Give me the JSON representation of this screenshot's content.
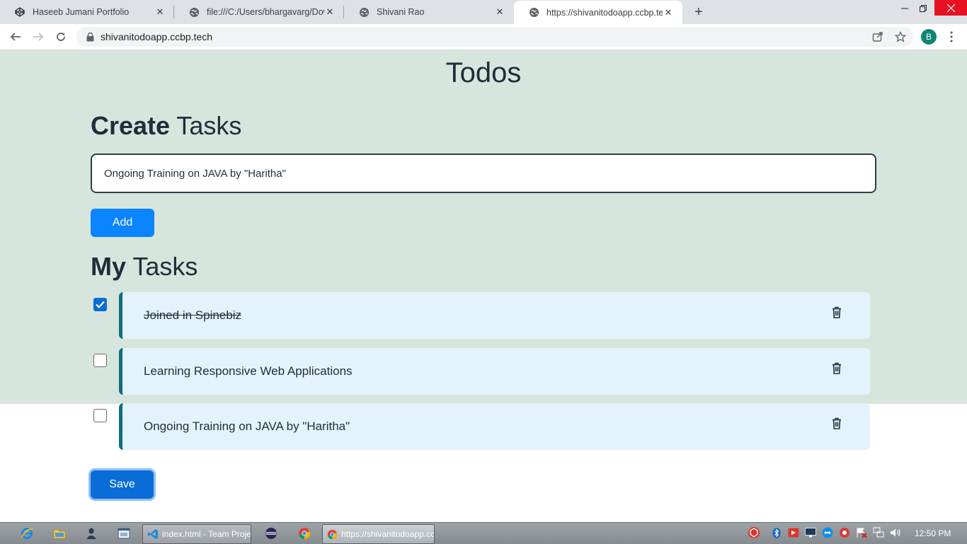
{
  "browser": {
    "tabs": [
      {
        "title": "Haseeb Jumani Portfolio",
        "icon": "codepen-icon"
      },
      {
        "title": "file:///C:/Users/bhargavarg/Downloads",
        "icon": "globe-icon"
      },
      {
        "title": "Shivani Rao",
        "icon": "globe-icon"
      },
      {
        "title": "https://shivanitodoapp.ccbp.tech",
        "icon": "globe-icon"
      }
    ],
    "new_tab_symbol": "+",
    "url": "shivanitodoapp.ccbp.tech",
    "profile_initial": "B"
  },
  "page": {
    "title": "Todos",
    "create_heading": {
      "bold": "Create",
      "rest": " Tasks"
    },
    "input_value": "Ongoing Training on JAVA by \"Haritha\"",
    "add_label": "Add",
    "my_heading": {
      "bold": "My",
      "rest": " Tasks"
    },
    "tasks": [
      {
        "label": "Joined in Spinebiz",
        "checked": true
      },
      {
        "label": "Learning Responsive Web Applications",
        "checked": false
      },
      {
        "label": "Ongoing Training on JAVA by \"Haritha\"",
        "checked": false
      }
    ],
    "save_label": "Save"
  },
  "taskbar": {
    "apps": [
      {
        "label": "index.html - Team Project - Visual Studio Code",
        "icon": "vscode-icon"
      },
      {
        "label": "https://shivanitodoapp.ccbp.tech - Google Chrome",
        "icon": "chrome-icon"
      }
    ],
    "clock": "12:50 PM"
  },
  "colors": {
    "page_bg": "#d7e6dc",
    "primary_button": "#0a84ff",
    "task_card": "#e3f3fb",
    "task_border": "#126b81",
    "heading_text": "#1e2e3a"
  }
}
